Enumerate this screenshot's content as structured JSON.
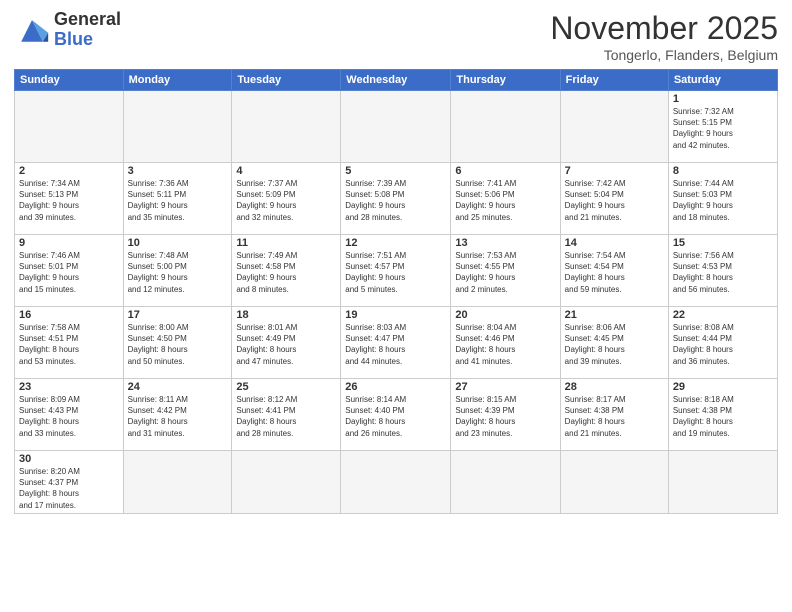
{
  "header": {
    "logo_general": "General",
    "logo_blue": "Blue",
    "month_title": "November 2025",
    "location": "Tongerlo, Flanders, Belgium"
  },
  "days_of_week": [
    "Sunday",
    "Monday",
    "Tuesday",
    "Wednesday",
    "Thursday",
    "Friday",
    "Saturday"
  ],
  "weeks": [
    [
      {
        "day": "",
        "info": "",
        "empty": true
      },
      {
        "day": "",
        "info": "",
        "empty": true
      },
      {
        "day": "",
        "info": "",
        "empty": true
      },
      {
        "day": "",
        "info": "",
        "empty": true
      },
      {
        "day": "",
        "info": "",
        "empty": true
      },
      {
        "day": "",
        "info": "",
        "empty": true
      },
      {
        "day": "1",
        "info": "Sunrise: 7:32 AM\nSunset: 5:15 PM\nDaylight: 9 hours\nand 42 minutes."
      }
    ],
    [
      {
        "day": "2",
        "info": "Sunrise: 7:34 AM\nSunset: 5:13 PM\nDaylight: 9 hours\nand 39 minutes."
      },
      {
        "day": "3",
        "info": "Sunrise: 7:36 AM\nSunset: 5:11 PM\nDaylight: 9 hours\nand 35 minutes."
      },
      {
        "day": "4",
        "info": "Sunrise: 7:37 AM\nSunset: 5:09 PM\nDaylight: 9 hours\nand 32 minutes."
      },
      {
        "day": "5",
        "info": "Sunrise: 7:39 AM\nSunset: 5:08 PM\nDaylight: 9 hours\nand 28 minutes."
      },
      {
        "day": "6",
        "info": "Sunrise: 7:41 AM\nSunset: 5:06 PM\nDaylight: 9 hours\nand 25 minutes."
      },
      {
        "day": "7",
        "info": "Sunrise: 7:42 AM\nSunset: 5:04 PM\nDaylight: 9 hours\nand 21 minutes."
      },
      {
        "day": "8",
        "info": "Sunrise: 7:44 AM\nSunset: 5:03 PM\nDaylight: 9 hours\nand 18 minutes."
      }
    ],
    [
      {
        "day": "9",
        "info": "Sunrise: 7:46 AM\nSunset: 5:01 PM\nDaylight: 9 hours\nand 15 minutes."
      },
      {
        "day": "10",
        "info": "Sunrise: 7:48 AM\nSunset: 5:00 PM\nDaylight: 9 hours\nand 12 minutes."
      },
      {
        "day": "11",
        "info": "Sunrise: 7:49 AM\nSunset: 4:58 PM\nDaylight: 9 hours\nand 8 minutes."
      },
      {
        "day": "12",
        "info": "Sunrise: 7:51 AM\nSunset: 4:57 PM\nDaylight: 9 hours\nand 5 minutes."
      },
      {
        "day": "13",
        "info": "Sunrise: 7:53 AM\nSunset: 4:55 PM\nDaylight: 9 hours\nand 2 minutes."
      },
      {
        "day": "14",
        "info": "Sunrise: 7:54 AM\nSunset: 4:54 PM\nDaylight: 8 hours\nand 59 minutes."
      },
      {
        "day": "15",
        "info": "Sunrise: 7:56 AM\nSunset: 4:53 PM\nDaylight: 8 hours\nand 56 minutes."
      }
    ],
    [
      {
        "day": "16",
        "info": "Sunrise: 7:58 AM\nSunset: 4:51 PM\nDaylight: 8 hours\nand 53 minutes."
      },
      {
        "day": "17",
        "info": "Sunrise: 8:00 AM\nSunset: 4:50 PM\nDaylight: 8 hours\nand 50 minutes."
      },
      {
        "day": "18",
        "info": "Sunrise: 8:01 AM\nSunset: 4:49 PM\nDaylight: 8 hours\nand 47 minutes."
      },
      {
        "day": "19",
        "info": "Sunrise: 8:03 AM\nSunset: 4:47 PM\nDaylight: 8 hours\nand 44 minutes."
      },
      {
        "day": "20",
        "info": "Sunrise: 8:04 AM\nSunset: 4:46 PM\nDaylight: 8 hours\nand 41 minutes."
      },
      {
        "day": "21",
        "info": "Sunrise: 8:06 AM\nSunset: 4:45 PM\nDaylight: 8 hours\nand 39 minutes."
      },
      {
        "day": "22",
        "info": "Sunrise: 8:08 AM\nSunset: 4:44 PM\nDaylight: 8 hours\nand 36 minutes."
      }
    ],
    [
      {
        "day": "23",
        "info": "Sunrise: 8:09 AM\nSunset: 4:43 PM\nDaylight: 8 hours\nand 33 minutes."
      },
      {
        "day": "24",
        "info": "Sunrise: 8:11 AM\nSunset: 4:42 PM\nDaylight: 8 hours\nand 31 minutes."
      },
      {
        "day": "25",
        "info": "Sunrise: 8:12 AM\nSunset: 4:41 PM\nDaylight: 8 hours\nand 28 minutes."
      },
      {
        "day": "26",
        "info": "Sunrise: 8:14 AM\nSunset: 4:40 PM\nDaylight: 8 hours\nand 26 minutes."
      },
      {
        "day": "27",
        "info": "Sunrise: 8:15 AM\nSunset: 4:39 PM\nDaylight: 8 hours\nand 23 minutes."
      },
      {
        "day": "28",
        "info": "Sunrise: 8:17 AM\nSunset: 4:38 PM\nDaylight: 8 hours\nand 21 minutes."
      },
      {
        "day": "29",
        "info": "Sunrise: 8:18 AM\nSunset: 4:38 PM\nDaylight: 8 hours\nand 19 minutes."
      }
    ],
    [
      {
        "day": "30",
        "info": "Sunrise: 8:20 AM\nSunset: 4:37 PM\nDaylight: 8 hours\nand 17 minutes.",
        "last": true
      },
      {
        "day": "",
        "info": "",
        "empty": true,
        "last": true
      },
      {
        "day": "",
        "info": "",
        "empty": true,
        "last": true
      },
      {
        "day": "",
        "info": "",
        "empty": true,
        "last": true
      },
      {
        "day": "",
        "info": "",
        "empty": true,
        "last": true
      },
      {
        "day": "",
        "info": "",
        "empty": true,
        "last": true
      },
      {
        "day": "",
        "info": "",
        "empty": true,
        "last": true
      }
    ]
  ]
}
